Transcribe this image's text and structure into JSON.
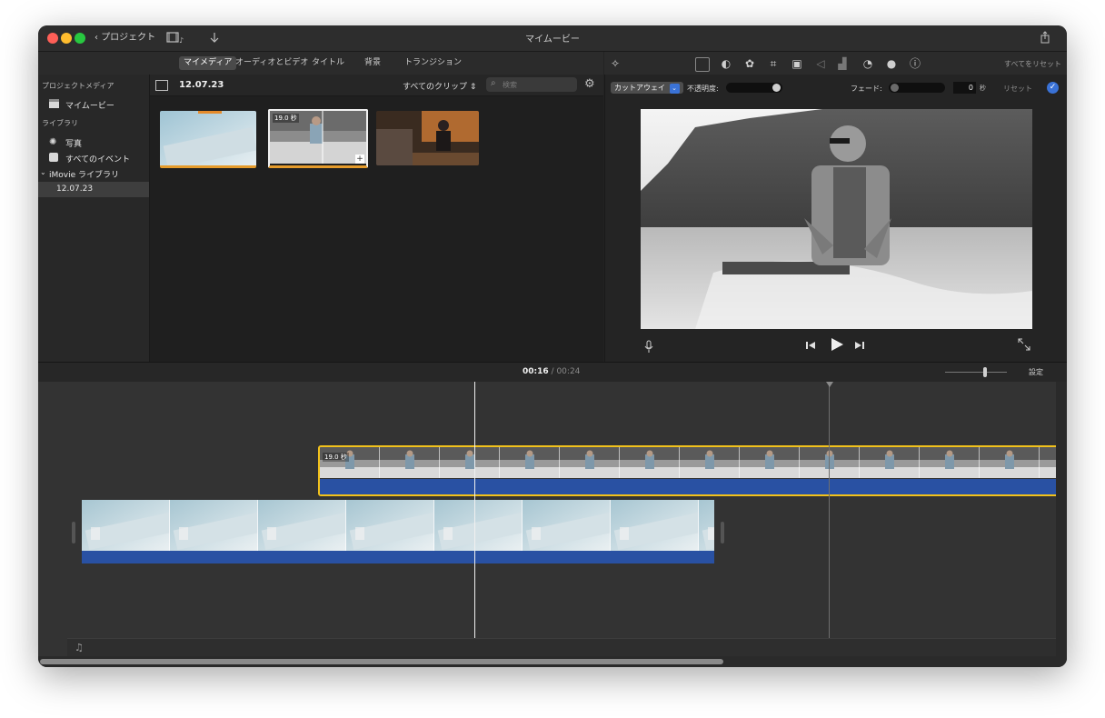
{
  "window": {
    "title": "マイムービー",
    "back_label": "プロジェクト"
  },
  "tabs": [
    {
      "label": "マイメディア",
      "active": true
    },
    {
      "label": "オーディオとビデオ"
    },
    {
      "label": "タイトル"
    },
    {
      "label": "背景"
    },
    {
      "label": "トランジション"
    }
  ],
  "adjust": {
    "reset_all": "すべてをリセット",
    "reset": "リセット",
    "cutaway": "カットアウェイ",
    "opacity_label": "不透明度:",
    "fade_label": "フェード:",
    "fade_value": "0",
    "fade_unit": "秒"
  },
  "sidebar": {
    "project_media_header": "プロジェクトメディア",
    "project_item": "マイムービー",
    "library_header": "ライブラリ",
    "photos": "写真",
    "all_events": "すべてのイベント",
    "library_name": "iMovie ライブラリ",
    "event": "12.07.23"
  },
  "browser": {
    "date": "12.07.23",
    "clip_filter": "すべてのクリップ",
    "search_placeholder": "検索",
    "thumb_duration": "19.0 秒"
  },
  "timeline": {
    "current": "00:16",
    "separator": "/",
    "total": "00:24",
    "settings": "設定",
    "clip_duration": "19.0 秒",
    "music_icon": "♫"
  },
  "colors": {
    "accent": "#3a72d6",
    "selection": "#f2c21b",
    "audio": "#2951a3"
  }
}
